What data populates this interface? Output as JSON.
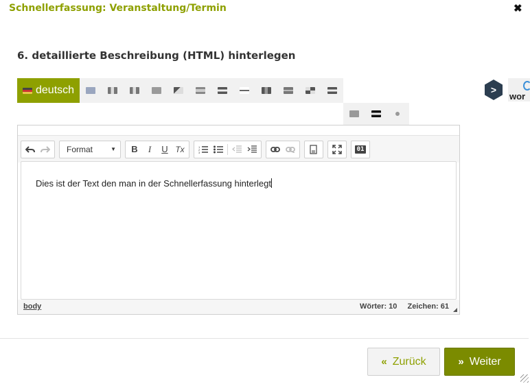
{
  "dialog": {
    "title": "Schnellerfassung: Veranstaltung/Termin",
    "close_glyph": "✖"
  },
  "section": {
    "title": "6. detaillierte Beschreibung (HTML) hinterlegen"
  },
  "languages": {
    "active": "deutsch",
    "flags": [
      {
        "name": "flag-english",
        "color": "#9aa6bf"
      },
      {
        "name": "flag-french",
        "color": "#7d7d7d"
      },
      {
        "name": "flag-italian",
        "color": "#7d7d7d"
      },
      {
        "name": "flag-gray-1",
        "color": "#9a9a9a"
      },
      {
        "name": "flag-czech",
        "color": "#6e6e6e"
      },
      {
        "name": "flag-spanish",
        "color": "#888888"
      },
      {
        "name": "flag-stripe-1",
        "color": "#5e5e5e"
      },
      {
        "name": "flag-stripe-2",
        "color": "#6e6e6e"
      },
      {
        "name": "flag-belgium",
        "color": "#6a6a6a"
      },
      {
        "name": "flag-swedish",
        "color": "#7a7a7a"
      },
      {
        "name": "flag-grid",
        "color": "#595959"
      },
      {
        "name": "flag-stripe-3",
        "color": "#5a5a5a"
      },
      {
        "name": "flag-turkish",
        "color": "#9a9a9a"
      },
      {
        "name": "flag-stripe-4",
        "color": "#111111"
      },
      {
        "name": "flag-dot",
        "color": "#8c8c8c"
      }
    ]
  },
  "widget": {
    "logo_glyph": ">",
    "text": "wor"
  },
  "toolbar": {
    "format_label": "Format",
    "bold": "B",
    "italic": "I",
    "underline": "U",
    "clear_format": "Tx",
    "source_badge": "01"
  },
  "editor": {
    "content": "Dies ist der Text den man in der Schnellerfassung hinterlegt"
  },
  "status": {
    "path": "body",
    "words": "Wörter: 10",
    "chars": "Zeichen: 61"
  },
  "footer": {
    "back_label": "Zurück",
    "next_label": "Weiter"
  },
  "colors": {
    "accent": "#8ea000",
    "primary_button": "#7b8b00"
  }
}
